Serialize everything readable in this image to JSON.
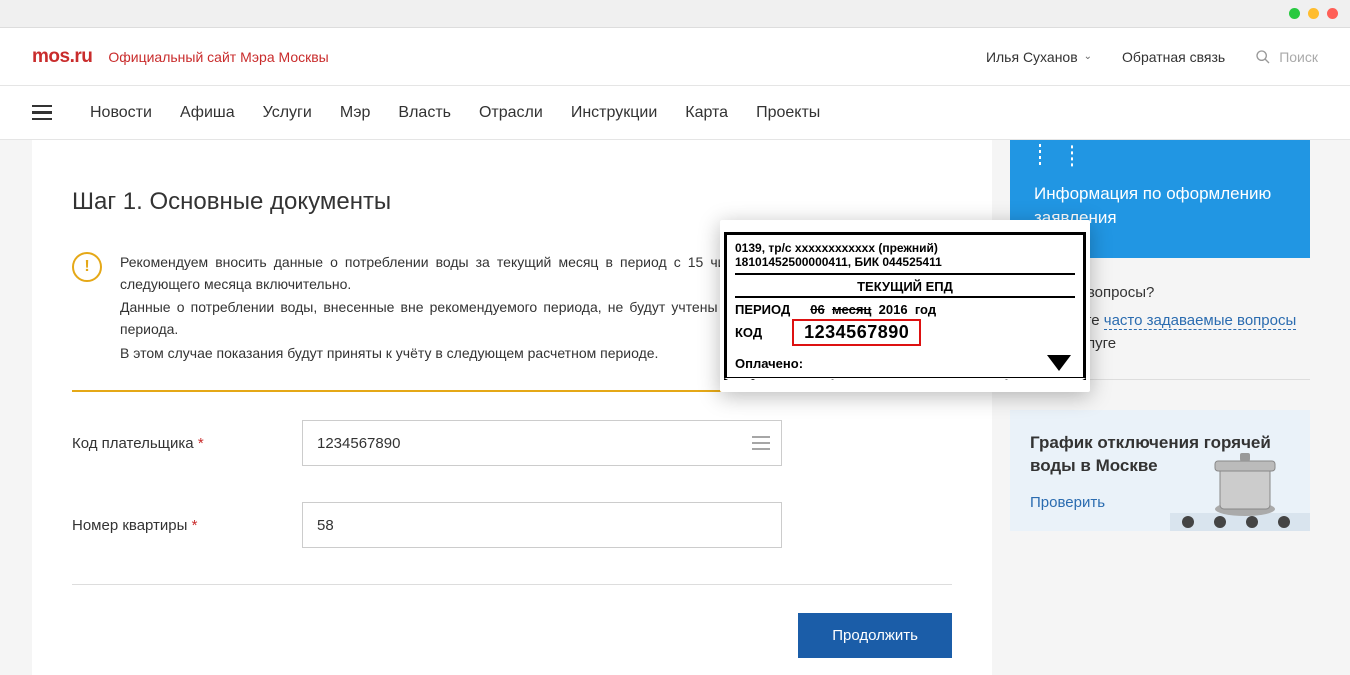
{
  "header": {
    "logo": "mos.ru",
    "tagline": "Официальный сайт Мэра Москвы",
    "user_name": "Илья Суханов",
    "feedback_label": "Обратная связь",
    "search_placeholder": "Поиск"
  },
  "nav": {
    "items": [
      "Новости",
      "Афиша",
      "Услуги",
      "Мэр",
      "Власть",
      "Отрасли",
      "Инструкции",
      "Карта",
      "Проекты"
    ]
  },
  "main": {
    "step_title": "Шаг 1. Основные документы",
    "notice": {
      "line1": "Рекомендуем вносить данные о потреблении воды за текущий месяц в период с 15 числа текущего месяца по 3 число следующего месяца включительно.",
      "line2": "Данные о потреблении воды, внесенные вне рекомендуемого периода, не будут учтены при расчете начислений текущего периода.",
      "line3": "В этом случае показания будут приняты к учёту в следующем расчетном периоде."
    },
    "form": {
      "payer_code_label": "Код плательщика",
      "payer_code_value": "1234567890",
      "apt_label": "Номер квартиры",
      "apt_value": "58"
    },
    "submit_label": "Продолжить"
  },
  "sidebar": {
    "info_title": "Информация по оформлению заявления",
    "help_q": "Остались вопросы?",
    "help_text_prefix": "Посмотрите ",
    "help_link": "часто задаваемые вопросы",
    "help_text_suffix": " по этой услуге",
    "promo_title": "График отключения горячей воды в Москве",
    "promo_link": "Проверить"
  },
  "tooltip": {
    "line1": "0139, тр/с хххххххххххх (прежний)",
    "line2": "18101452500000411, БИК 044525411",
    "header": "ТЕКУЩИЙ ЕПД",
    "period_label": "ПЕРИОД",
    "period_month": "06",
    "period_month_word": "месяц",
    "period_year": "2016",
    "period_year_word": "год",
    "code_label": "КОД",
    "code_value": "1234567890",
    "paid_label": "Оплачено:"
  }
}
